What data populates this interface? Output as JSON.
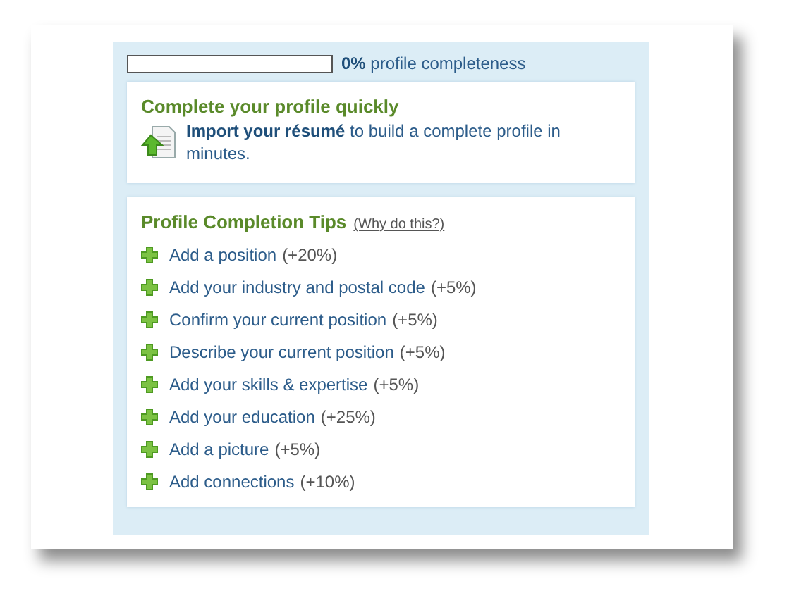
{
  "progress": {
    "level": 0,
    "percent": "0%",
    "label": "profile completeness"
  },
  "quick": {
    "title": "Complete your profile quickly",
    "link": "Import your résumé",
    "text": "to build a complete profile in minutes."
  },
  "tips": {
    "title": "Profile Completion Tips",
    "help_link": "(Why do this?)",
    "items": [
      {
        "action": "Add a position",
        "gain": "(+20%)"
      },
      {
        "action": "Add your industry and postal code",
        "gain": "(+5%)"
      },
      {
        "action": "Confirm your current position",
        "gain": "(+5%)"
      },
      {
        "action": "Describe your current position",
        "gain": "(+5%)"
      },
      {
        "action": "Add your skills & expertise",
        "gain": "(+5%)"
      },
      {
        "action": "Add your education",
        "gain": "(+25%)"
      },
      {
        "action": "Add a picture",
        "gain": "(+5%)"
      },
      {
        "action": "Add connections",
        "gain": "(+10%)"
      }
    ]
  }
}
